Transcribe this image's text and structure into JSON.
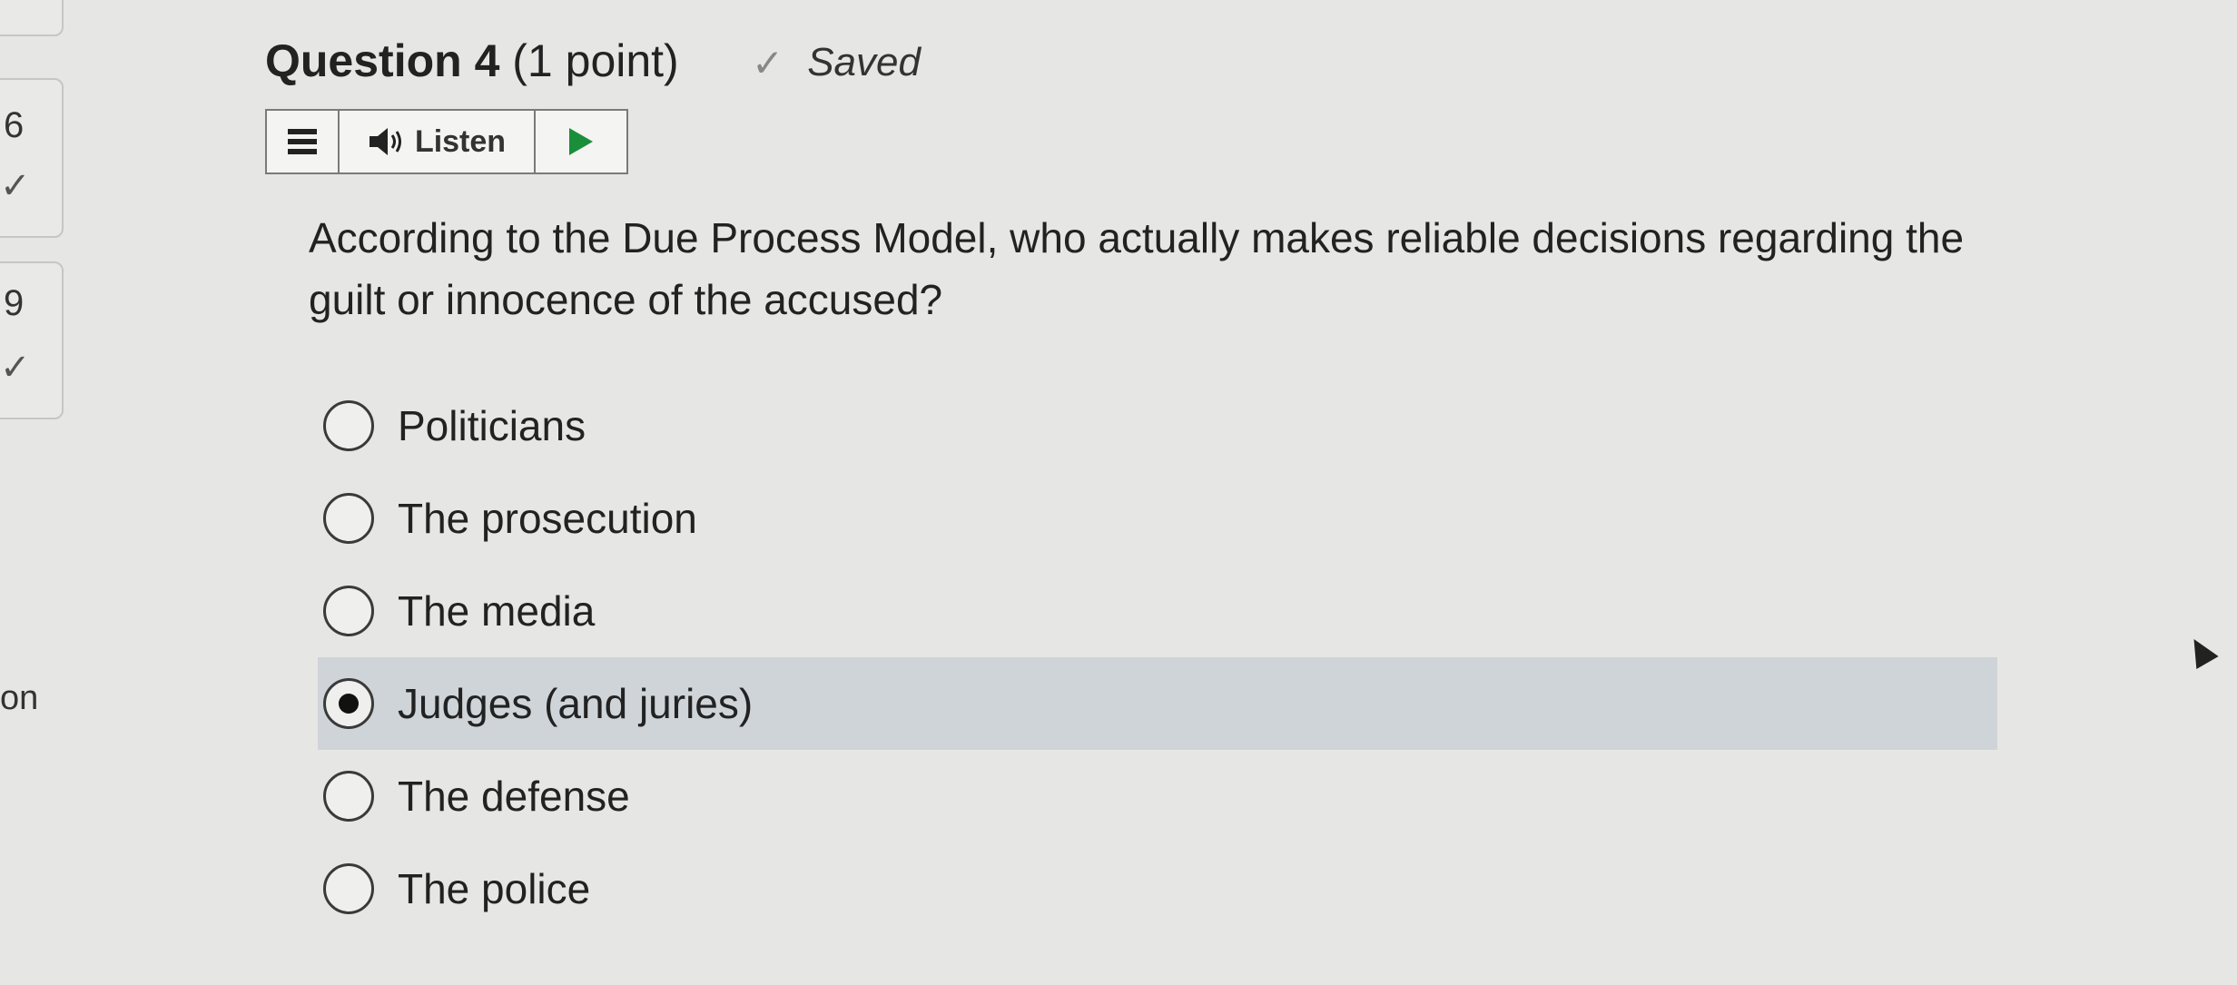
{
  "nav": {
    "card1": {
      "number": "6",
      "check": "✓"
    },
    "card2": {
      "number": "9",
      "check": "✓"
    },
    "side_text": "on"
  },
  "header": {
    "question_number": "Question 4",
    "points": "(1 point)",
    "saved_icon": "check-icon",
    "saved_label": "Saved"
  },
  "listen_bar": {
    "menu_icon": "hamburger-menu-icon",
    "speaker_icon": "speaker-icon",
    "listen_label": "Listen",
    "play_icon": "play-icon"
  },
  "question": {
    "text": "According to the Due Process Model, who actually makes reliable decisions regarding the guilt or innocence of the accused?"
  },
  "options": [
    {
      "label": "Politicians",
      "selected": false
    },
    {
      "label": "The prosecution",
      "selected": false
    },
    {
      "label": "The media",
      "selected": false
    },
    {
      "label": "Judges (and juries)",
      "selected": true
    },
    {
      "label": "The defense",
      "selected": false
    },
    {
      "label": "The police",
      "selected": false
    }
  ],
  "colors": {
    "selected_row": "#cfd4d8",
    "play_icon": "#1a8f3a"
  }
}
